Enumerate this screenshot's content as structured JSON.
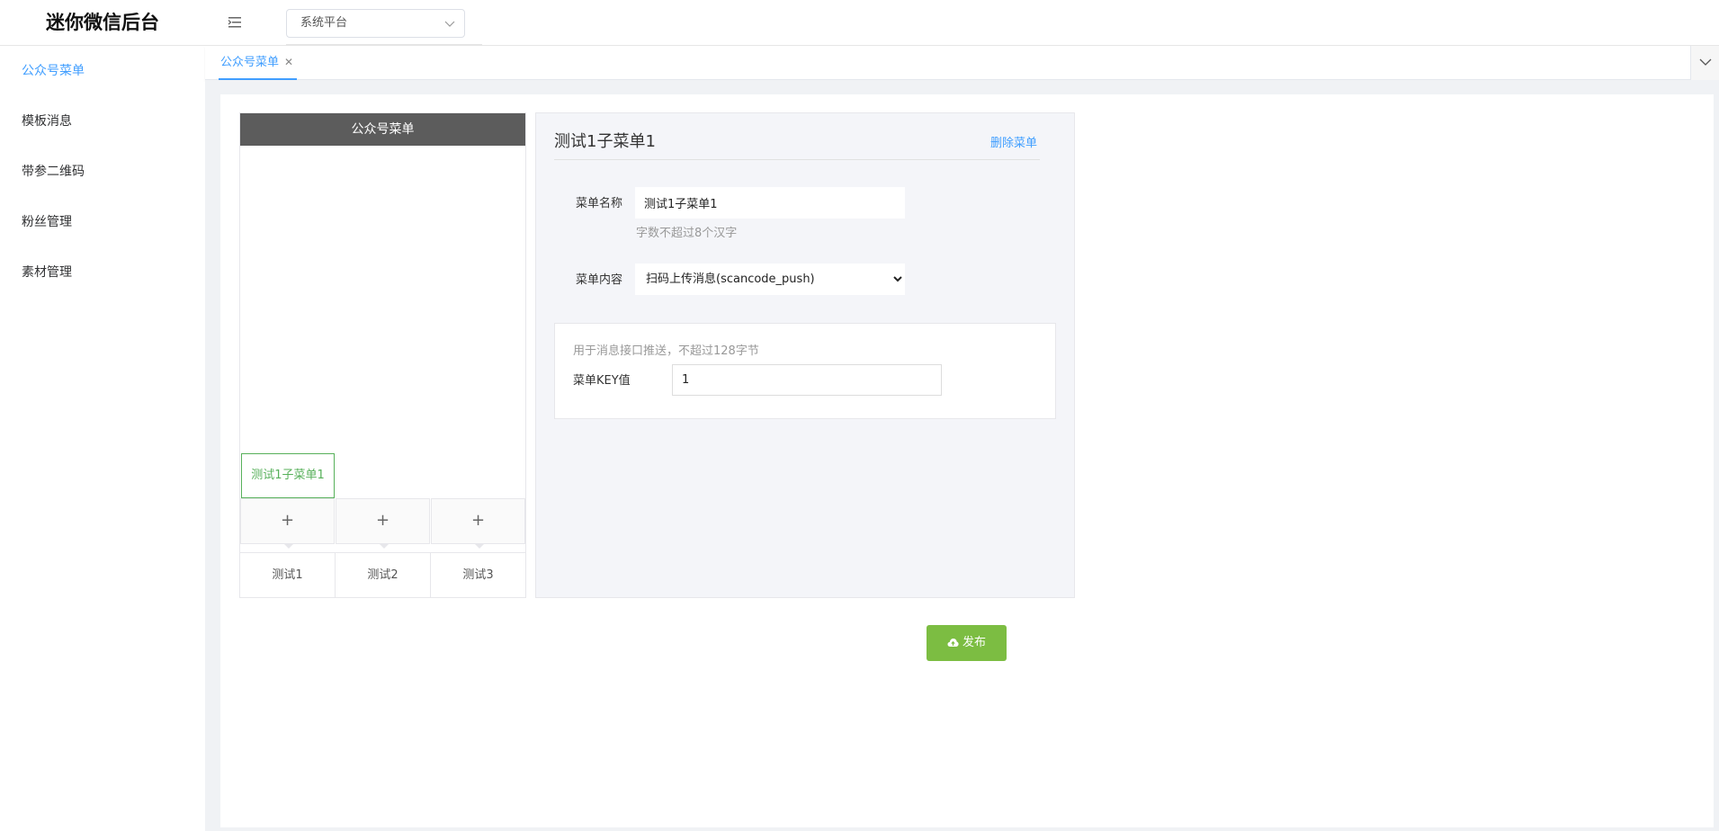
{
  "header": {
    "app_title": "迷你微信后台",
    "platform_select": {
      "value": "系统平台"
    }
  },
  "sidebar": {
    "items": [
      {
        "label": "公众号菜单",
        "active": true
      },
      {
        "label": "模板消息"
      },
      {
        "label": "带参二维码"
      },
      {
        "label": "粉丝管理"
      },
      {
        "label": "素材管理"
      }
    ]
  },
  "tabs": [
    {
      "label": "公众号菜单",
      "active": true
    }
  ],
  "preview": {
    "header": "公众号菜单",
    "active_submenu": "测试1子菜单1",
    "add_label": "+",
    "main_menus": [
      "测试1",
      "测试2",
      "测试3"
    ]
  },
  "editor": {
    "title": "测试1子菜单1",
    "delete_label": "删除菜单",
    "name_label": "菜单名称",
    "name_value": "测试1子菜单1",
    "name_hint": "字数不超过8个汉字",
    "content_label": "菜单内容",
    "content_value": "扫码上传消息(scancode_push)",
    "key_hint": "用于消息接口推送，不超过128字节",
    "key_label": "菜单KEY值",
    "key_value": "1"
  },
  "publish_label": "发布",
  "colors": {
    "accent": "#409eff",
    "green": "#57b05a",
    "publish": "#7cbd42",
    "preview_header": "#5c5c5c"
  }
}
